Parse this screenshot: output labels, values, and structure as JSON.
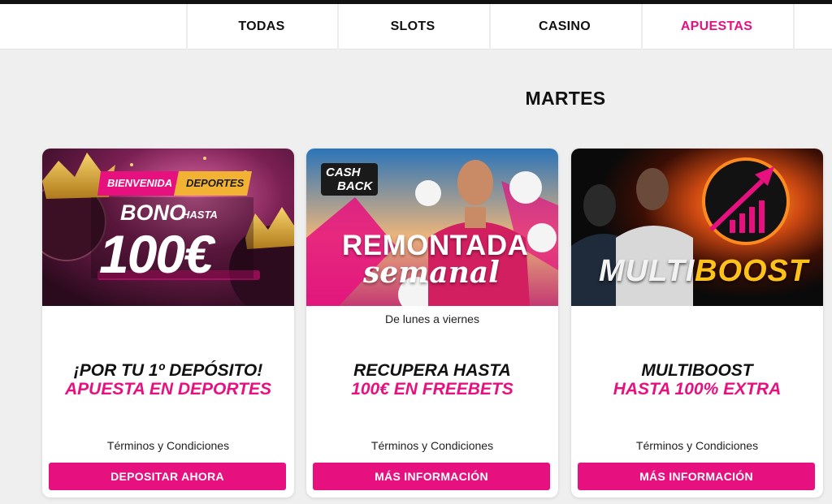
{
  "nav": {
    "tabs": [
      {
        "label": "TODAS"
      },
      {
        "label": "SLOTS"
      },
      {
        "label": "CASINO"
      },
      {
        "label": "APUESTAS",
        "active": true
      }
    ]
  },
  "section": {
    "day_title": "MARTES"
  },
  "colors": {
    "accent": "#e6117f",
    "text": "#111111",
    "background": "#efefef"
  },
  "cards": [
    {
      "banner": {
        "tag_left": "BIENVENIDA",
        "tag_right": "DEPORTES",
        "line1": "BONO",
        "line1_small": "HASTA",
        "amount": "100€"
      },
      "subtitle": "",
      "headline_1": "¡POR TU 1º DEPÓSITO!",
      "headline_2": "APUESTA EN DEPORTES",
      "terms": "Términos y Condiciones",
      "cta": "DEPOSITAR AHORA"
    },
    {
      "banner": {
        "badge_1": "CASH",
        "badge_2": "BACK",
        "title": "REMONTADA",
        "script": "semanal"
      },
      "subtitle": "De lunes a viernes",
      "headline_1": "RECUPERA HASTA",
      "headline_2": "100€ EN FREEBETS",
      "terms": "Términos y Condiciones",
      "cta": "MÁS INFORMACIÓN"
    },
    {
      "banner": {
        "word_1": "MULTI",
        "word_2": "BOOST"
      },
      "subtitle": "",
      "headline_1": "MULTIBOOST",
      "headline_2": "HASTA 100% EXTRA",
      "terms": "Términos y Condiciones",
      "cta": "MÁS INFORMACIÓN"
    }
  ]
}
